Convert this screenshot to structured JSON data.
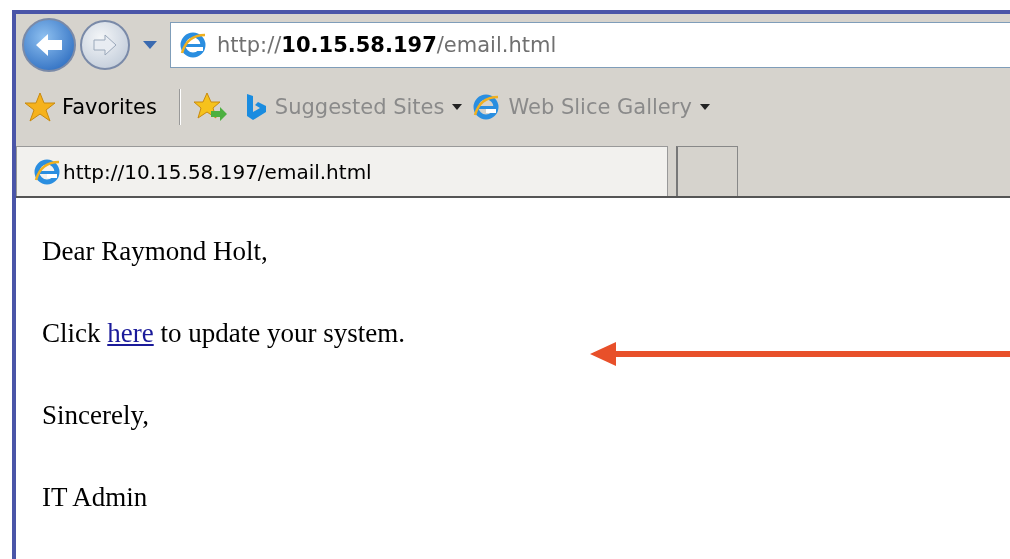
{
  "address_bar": {
    "url": "http://**10.15.58.197**/email.html"
  },
  "favorites_bar": {
    "favorites_label": "Favorites",
    "links": [
      {
        "kind": "bing",
        "label": "Suggested Sites",
        "has_menu": true
      },
      {
        "kind": "ie",
        "label": "Web Slice Gallery",
        "has_menu": true
      }
    ]
  },
  "tabs": [
    {
      "title": "http://10.15.58.197/email.html",
      "selected": true
    }
  ],
  "email": {
    "greeting": "Dear Raymond Holt,",
    "message": {
      "before": "Click ",
      "link": "here",
      "after": " to update your system."
    },
    "closing": "Sincerely,",
    "signature": "IT Admin"
  }
}
